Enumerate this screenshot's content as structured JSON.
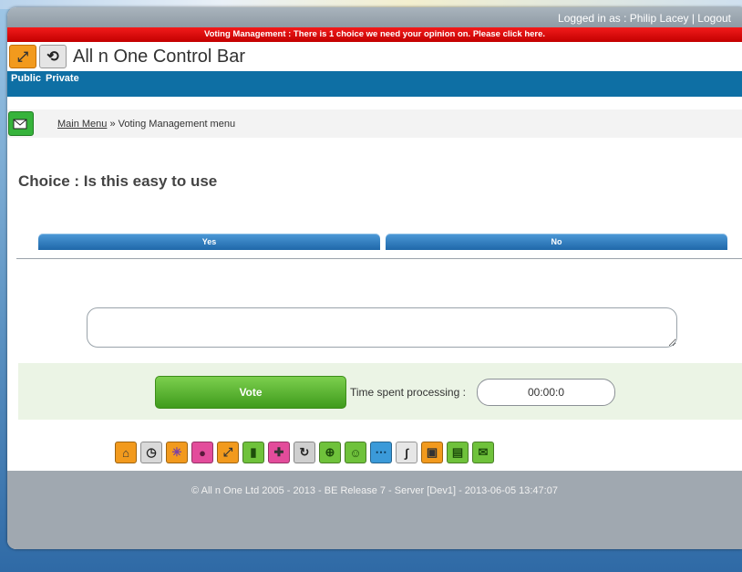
{
  "login": {
    "prefix": "Logged in as : ",
    "user": "Philip Lacey",
    "separator": " | ",
    "logout": "Logout"
  },
  "alert": "Voting Management : There is 1 choice we need your opinion on.  Please click here.",
  "brand": {
    "title": "All n One Control Bar"
  },
  "nav": [
    "Public",
    "Private"
  ],
  "breadcrumb": {
    "main": "Main Menu",
    "sep": " » ",
    "current": "Voting Management menu"
  },
  "choice": {
    "title": "Choice : Is this easy to use"
  },
  "options": [
    "Yes",
    "No"
  ],
  "comment": {
    "value": ""
  },
  "vote": {
    "button": "Vote",
    "time_label": "Time spent processing :",
    "time_value": "00:00:0"
  },
  "toolbar": [
    {
      "name": "home-icon",
      "bg": "#f29a1d",
      "glyph": "⌂",
      "color": "#333"
    },
    {
      "name": "clock-icon",
      "bg": "#d9d9d9",
      "glyph": "◷",
      "color": "#222"
    },
    {
      "name": "atom-icon",
      "bg": "#f29a1d",
      "glyph": "✳",
      "color": "#7a3fa6"
    },
    {
      "name": "people-icon",
      "bg": "#e34c9b",
      "glyph": "●",
      "color": "#5a1a3b"
    },
    {
      "name": "arrows-icon",
      "bg": "#f29a1d",
      "glyph": "⤢",
      "color": "#333"
    },
    {
      "name": "bar-chart-icon",
      "bg": "#6fc23b",
      "glyph": "▮",
      "color": "#1d4d0b"
    },
    {
      "name": "puzzle-icon",
      "bg": "#e34c9b",
      "glyph": "✚",
      "color": "#333"
    },
    {
      "name": "refresh-icon",
      "bg": "#cfcfcf",
      "glyph": "↻",
      "color": "#222"
    },
    {
      "name": "globe-icon",
      "bg": "#6fc23b",
      "glyph": "⊕",
      "color": "#1d4d0b"
    },
    {
      "name": "support-icon",
      "bg": "#6fc23b",
      "glyph": "☺",
      "color": "#1d4d0b"
    },
    {
      "name": "network-icon",
      "bg": "#3b9ad9",
      "glyph": "⋯",
      "color": "#0b3552"
    },
    {
      "name": "signature-icon",
      "bg": "#e6e6e6",
      "glyph": "∫",
      "color": "#222"
    },
    {
      "name": "calendar-icon",
      "bg": "#f29a1d",
      "glyph": "▣",
      "color": "#333"
    },
    {
      "name": "document-icon",
      "bg": "#6fc23b",
      "glyph": "▤",
      "color": "#1d4d0b"
    },
    {
      "name": "mail-icon",
      "bg": "#6fc23b",
      "glyph": "✉",
      "color": "#1d4d0b"
    }
  ],
  "footer": "© All n One Ltd 2005 - 2013 - BE Release 7 - Server [Dev1] - 2013-06-05 13:47:07"
}
